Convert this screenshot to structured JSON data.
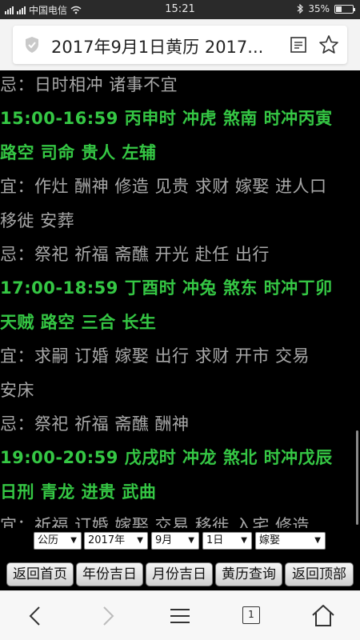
{
  "status": {
    "carrier": "中国电信",
    "time": "15:21",
    "battery": "35%",
    "battery_level": 0.35
  },
  "browser": {
    "page_title": "2017年9月1日黄历 2017..."
  },
  "content": {
    "lines": [
      {
        "text": "忌：日时相冲 诸事不宜",
        "style": "gray"
      },
      {
        "text": "15:00-16:59 丙申时 冲虎 煞南 时冲丙寅",
        "style": "green"
      },
      {
        "text": "路空 司命 贵人 左辅",
        "style": "green"
      },
      {
        "text": "宜：作灶 酬神 修造 见贵 求财 嫁娶 进人口",
        "style": "gray"
      },
      {
        "text": "移徙 安葬",
        "style": "gray"
      },
      {
        "text": "忌：祭祀 祈福 斋醮 开光 赴任 出行",
        "style": "gray"
      },
      {
        "text": "17:00-18:59 丁酉时 冲兔 煞东 时冲丁卯",
        "style": "green"
      },
      {
        "text": "天贼 路空 三合 长生",
        "style": "green"
      },
      {
        "text": "宜：求嗣 订婚 嫁娶 出行 求财 开市 交易",
        "style": "gray"
      },
      {
        "text": "安床",
        "style": "gray"
      },
      {
        "text": "忌：祭祀 祈福 斋醮 酬神",
        "style": "gray"
      },
      {
        "text": "19:00-20:59 戊戌时 冲龙 煞北 时冲戊辰",
        "style": "green"
      },
      {
        "text": "日刑 青龙 进贵 武曲",
        "style": "green"
      },
      {
        "text": "宜：祈福 订婚 嫁娶 交易 移徙 入宅 修造",
        "style": "gray"
      }
    ]
  },
  "selectors": {
    "calendar_type": "公历",
    "year": "2017年",
    "month": "9月",
    "day": "1日",
    "event": "嫁娶"
  },
  "nav": {
    "home": "返回首页",
    "year_lucky": "年份吉日",
    "month_lucky": "月份吉日",
    "almanac_query": "黄历查询",
    "back_to_top": "返回顶部"
  },
  "toolbar": {
    "tab_count": "1"
  },
  "colors": {
    "green_text": "#35c744",
    "gray_text": "#a8a8a8",
    "background": "#000000"
  }
}
